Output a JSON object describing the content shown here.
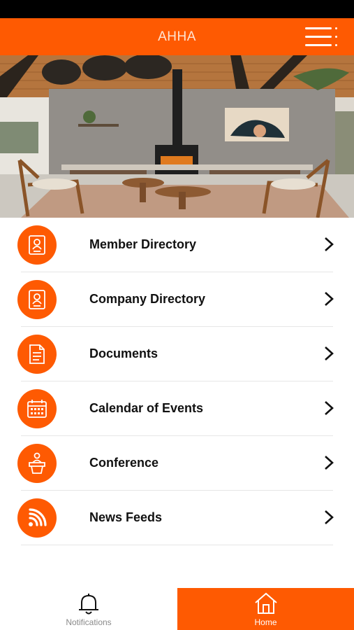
{
  "header": {
    "title": "AHHA",
    "menu_icon": "hamburger-menu-icon"
  },
  "hero": {
    "description_icon": "hero-photo"
  },
  "menu": {
    "items": [
      {
        "label": "Member Directory",
        "icon": "contact-card-icon"
      },
      {
        "label": "Company Directory",
        "icon": "contact-card-icon"
      },
      {
        "label": "Documents",
        "icon": "document-icon"
      },
      {
        "label": "Calendar of Events",
        "icon": "calendar-icon"
      },
      {
        "label": "Conference",
        "icon": "podium-speaker-icon"
      },
      {
        "label": "News Feeds",
        "icon": "rss-icon"
      }
    ]
  },
  "tabs": {
    "notifications": {
      "label": "Notifications",
      "icon": "bell-icon"
    },
    "home": {
      "label": "Home",
      "icon": "home-icon"
    }
  },
  "colors": {
    "accent": "#fe5a02",
    "status_bar": "#000000"
  }
}
